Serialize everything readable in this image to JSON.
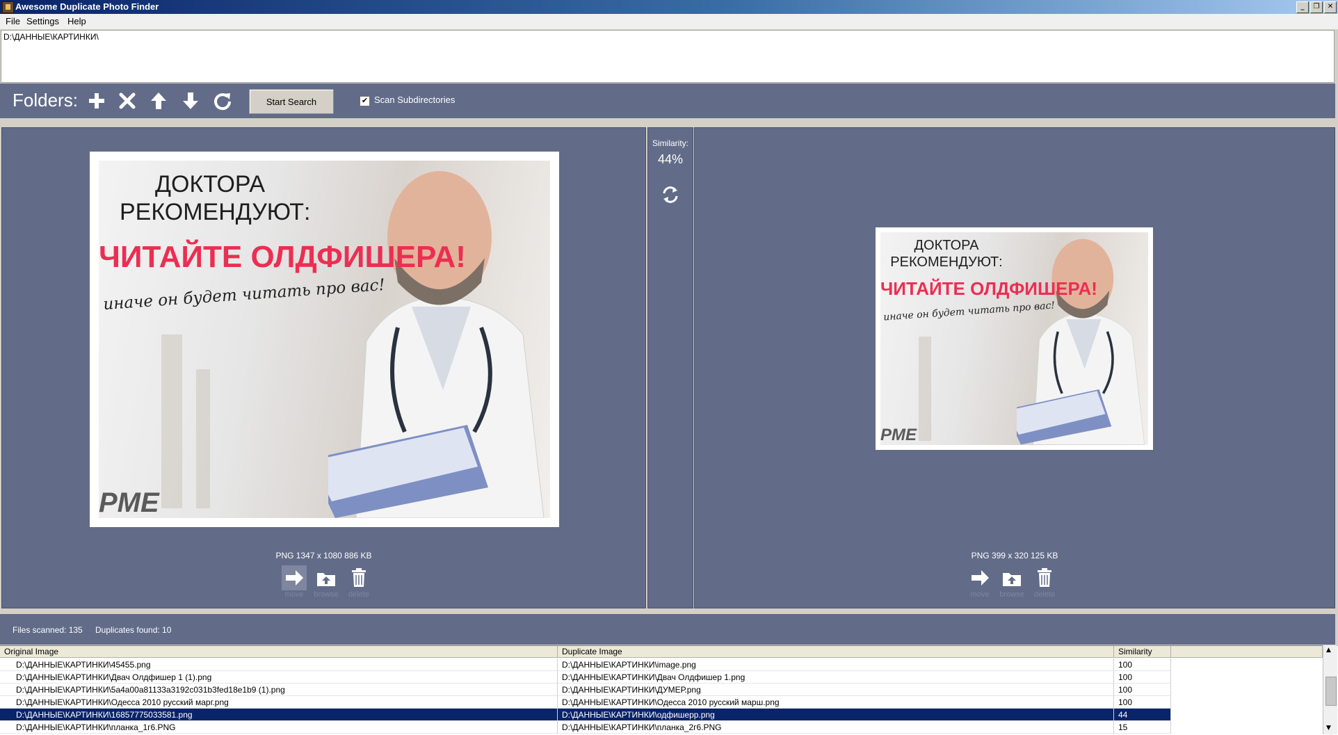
{
  "window": {
    "title": "Awesome Duplicate Photo Finder",
    "controls": [
      "_",
      "❐",
      "✕"
    ]
  },
  "menu": [
    "File",
    "Settings",
    "Help"
  ],
  "folders": [
    "D:\\ДАННЫЕ\\КАРТИНКИ\\"
  ],
  "toolbar": {
    "folders_label": "Folders:",
    "start_label": "Start Search",
    "scan_sub_label": "Scan Subdirectories",
    "scan_sub_checked": true
  },
  "compare": {
    "similarity_label": "Similarity:",
    "similarity_value": "44%",
    "left": {
      "info": "PNG  1347 x 1080  886 KB",
      "image_text": {
        "line1": "ДОКТОРА",
        "line2": "РЕКОМЕНДУЮТ:",
        "headline": "ЧИТАЙТЕ ОЛДФИШЕРА!",
        "script": "иначе он будет читать про вас!",
        "watermark": "PME"
      },
      "actions": {
        "move": "move",
        "browse": "browse",
        "delete": "delete"
      }
    },
    "right": {
      "info": "PNG  399 x 320  125 KB",
      "image_text": {
        "line1": "ДОКТОРА",
        "line2": "РЕКОМЕНДУЮТ:",
        "headline": "ЧИТАЙТЕ ОЛДФИШЕРА!",
        "script": "иначе он будет читать про вас!",
        "watermark": "PME"
      },
      "actions": {
        "move": "move",
        "browse": "browse",
        "delete": "delete"
      }
    }
  },
  "status": {
    "files_scanned": "Files scanned: 135",
    "duplicates_found": "Duplicates found: 10"
  },
  "grid": {
    "headers": [
      "Original Image",
      "Duplicate Image",
      "Similarity"
    ],
    "rows": [
      {
        "original": "D:\\ДАННЫЕ\\КАРТИНКИ\\45455.png",
        "duplicate": "D:\\ДАННЫЕ\\КАРТИНКИ\\image.png",
        "similarity": "100"
      },
      {
        "original": "D:\\ДАННЫЕ\\КАРТИНКИ\\Двач Олдфишер 1 (1).png",
        "duplicate": "D:\\ДАННЫЕ\\КАРТИНКИ\\Двач Олдфишер 1.png",
        "similarity": "100"
      },
      {
        "original": "D:\\ДАННЫЕ\\КАРТИНКИ\\5a4a00a81133a3192c031b3fed18e1b9 (1).png",
        "duplicate": "D:\\ДАННЫЕ\\КАРТИНКИ\\ДУМЕР.png",
        "similarity": "100"
      },
      {
        "original": "D:\\ДАННЫЕ\\КАРТИНКИ\\Одесса 2010 русский марг.png",
        "duplicate": "D:\\ДАННЫЕ\\КАРТИНКИ\\Одесса 2010 русский марш.png",
        "similarity": "100"
      },
      {
        "original": "D:\\ДАННЫЕ\\КАРТИНКИ\\16857775033581.png",
        "duplicate": "D:\\ДАННЫЕ\\КАРТИНКИ\\одфишерр.png",
        "similarity": "44",
        "selected": true
      },
      {
        "original": "D:\\ДАННЫЕ\\КАРТИНКИ\\планка_1г6.PNG",
        "duplicate": "D:\\ДАННЫЕ\\КАРТИНКИ\\планка_2г6.PNG",
        "similarity": "15"
      }
    ]
  },
  "colors": {
    "panel": "#626c88",
    "selection": "#0a246a",
    "headline": "#ec2e52"
  }
}
